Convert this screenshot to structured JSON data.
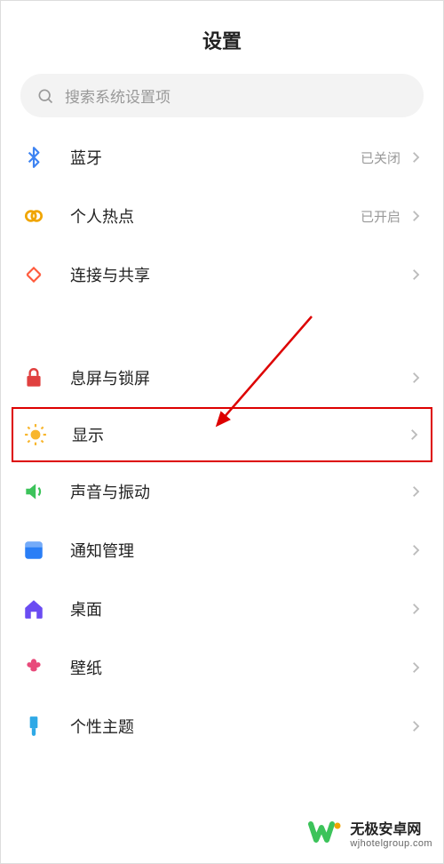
{
  "title": "设置",
  "search": {
    "placeholder": "搜索系统设置项"
  },
  "group1": [
    {
      "key": "bluetooth",
      "label": "蓝牙",
      "status": "已关闭",
      "icon": "bluetooth",
      "color": "#3d83f2"
    },
    {
      "key": "hotspot",
      "label": "个人热点",
      "status": "已开启",
      "icon": "link",
      "color": "#f0a500"
    },
    {
      "key": "connect",
      "label": "连接与共享",
      "status": "",
      "icon": "share",
      "color": "#ff5a3c"
    }
  ],
  "group2": [
    {
      "key": "lock",
      "label": "息屏与锁屏",
      "icon": "lock",
      "color": "#e0403f"
    },
    {
      "key": "display",
      "label": "显示",
      "icon": "sun",
      "color": "#f8b62d",
      "highlight": true
    },
    {
      "key": "sound",
      "label": "声音与振动",
      "icon": "volume",
      "color": "#3cc35a"
    },
    {
      "key": "notify",
      "label": "通知管理",
      "icon": "notify",
      "color": "#2a7ef6"
    },
    {
      "key": "home",
      "label": "桌面",
      "icon": "home",
      "color": "#6a4cf2"
    },
    {
      "key": "wallpaper",
      "label": "壁纸",
      "icon": "flower",
      "color": "#e84a7b"
    },
    {
      "key": "theme",
      "label": "个性主题",
      "icon": "brush",
      "color": "#2fa9e6"
    }
  ],
  "watermark": {
    "title": "无极安卓网",
    "url": "wjhotelgroup.com"
  }
}
